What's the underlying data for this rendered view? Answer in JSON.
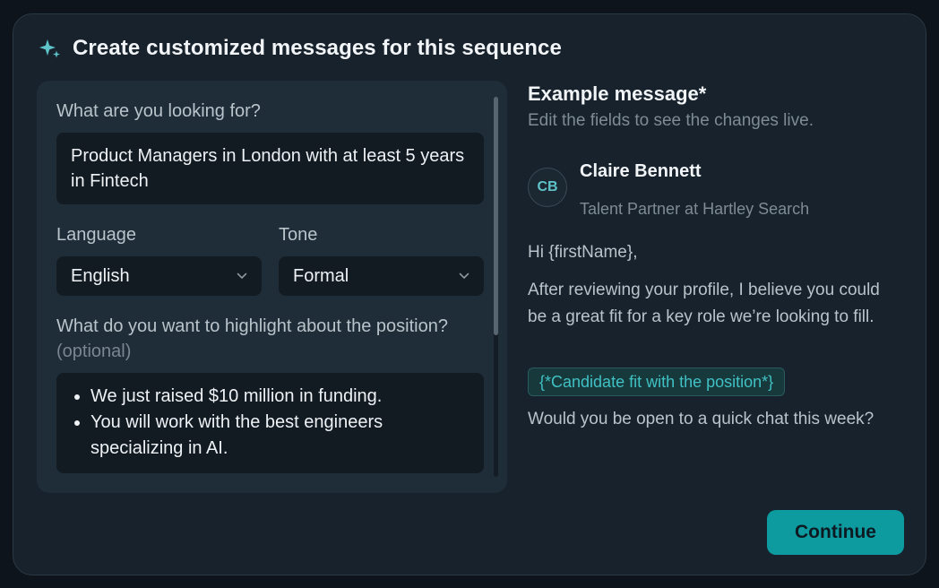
{
  "header": {
    "title": "Create customized messages for this sequence",
    "icon": "sparkle-icon",
    "accent_color": "#5ec4c9"
  },
  "form": {
    "looking_for": {
      "label": "What are you looking for?",
      "value": "Product Managers in London with at least 5 years in Fintech"
    },
    "language": {
      "label": "Language",
      "value": "English"
    },
    "tone": {
      "label": "Tone",
      "value": "Formal"
    },
    "highlight": {
      "label": "What do you want to highlight about the position?",
      "optional": "(optional)",
      "items": [
        "We just raised $10 million in funding.",
        "You will work with the best engineers specializing in AI."
      ]
    }
  },
  "preview": {
    "title": "Example message*",
    "subtitle": "Edit the fields to see the changes live.",
    "sender": {
      "initials": "CB",
      "name": "Claire Bennett",
      "role": "Talent Partner at Hartley Search"
    },
    "greeting": "Hi {firstName},",
    "body1": "After reviewing your profile, I believe you could be a great fit for a key role we’re looking to fill.",
    "variable_chip": "{*Candidate fit with the position*}",
    "body2": "Would you be open to a quick chat this week?"
  },
  "actions": {
    "continue_label": "Continue",
    "button_color": "#0d9ba0"
  }
}
